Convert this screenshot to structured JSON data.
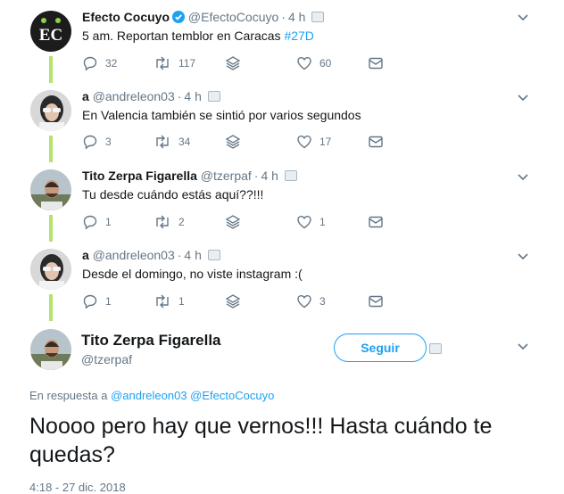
{
  "tweets": [
    {
      "name": "Efecto Cocuyo",
      "handle": "@EfectoCocuyo",
      "time": "4 h",
      "verified": true,
      "text_prefix": "5 am. Reportan temblor en Caracas ",
      "hashtag": "#27D",
      "replies": "32",
      "retweets": "117",
      "likes": "60",
      "avatar_initials": "EC"
    },
    {
      "name": "a",
      "handle": "@andreleon03",
      "time": "4 h",
      "text": "En Valencia también se sintió por varios segundos",
      "replies": "3",
      "retweets": "34",
      "likes": "17"
    },
    {
      "name": "Tito Zerpa Figarella",
      "handle": "@tzerpaf",
      "time": "4 h",
      "text": "Tu desde cuándo estás aquí??!!!",
      "replies": "1",
      "retweets": "2",
      "likes": "1"
    },
    {
      "name": "a",
      "handle": "@andreleon03",
      "time": "4 h",
      "text": "Desde el domingo, no viste instagram :(",
      "replies": "1",
      "retweets": "1",
      "likes": "3"
    }
  ],
  "focused": {
    "name": "Tito Zerpa Figarella",
    "handle": "@tzerpaf",
    "follow_label": "Seguir",
    "reply_prefix": "En respuesta a ",
    "reply_user1": "@andreleon03",
    "reply_user2": "@EfectoCocuyo",
    "text": "Noooo pero hay que vernos!!! Hasta cuándo te quedas?",
    "timestamp": "4:18 - 27 dic. 2018"
  },
  "colors": {
    "accent": "#1da1f2",
    "thread_line": "#b4e36d",
    "muted": "#657786"
  }
}
